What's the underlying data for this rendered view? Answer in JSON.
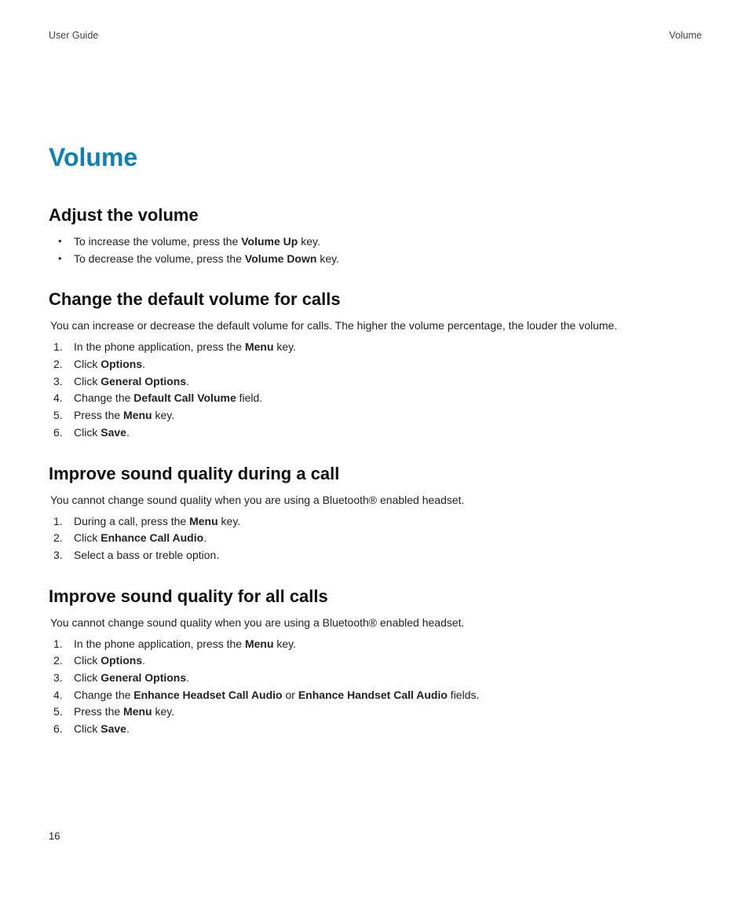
{
  "header": {
    "left": "User Guide",
    "right": "Volume"
  },
  "title": "Volume",
  "sections": [
    {
      "heading": "Adjust the volume",
      "intro": "",
      "listType": "ul",
      "items": [
        [
          {
            "t": "To increase the volume, press the "
          },
          {
            "t": "Volume Up",
            "b": true
          },
          {
            "t": " key."
          }
        ],
        [
          {
            "t": "To decrease the volume, press the "
          },
          {
            "t": "Volume Down",
            "b": true
          },
          {
            "t": " key."
          }
        ]
      ]
    },
    {
      "heading": "Change the default volume for calls",
      "intro": "You can increase or decrease the default volume for calls. The higher the volume percentage, the louder the volume.",
      "listType": "ol",
      "items": [
        [
          {
            "t": "In the phone application, press the "
          },
          {
            "t": "Menu",
            "b": true
          },
          {
            "t": " key."
          }
        ],
        [
          {
            "t": "Click "
          },
          {
            "t": "Options",
            "b": true
          },
          {
            "t": "."
          }
        ],
        [
          {
            "t": "Click "
          },
          {
            "t": "General Options",
            "b": true
          },
          {
            "t": "."
          }
        ],
        [
          {
            "t": "Change the "
          },
          {
            "t": "Default Call Volume",
            "b": true
          },
          {
            "t": " field."
          }
        ],
        [
          {
            "t": "Press the "
          },
          {
            "t": "Menu",
            "b": true
          },
          {
            "t": " key."
          }
        ],
        [
          {
            "t": "Click "
          },
          {
            "t": "Save",
            "b": true
          },
          {
            "t": "."
          }
        ]
      ]
    },
    {
      "heading": "Improve sound quality during a call",
      "intro": "You cannot change sound quality when you are using a Bluetooth® enabled headset.",
      "listType": "ol",
      "items": [
        [
          {
            "t": "During a call, press the "
          },
          {
            "t": "Menu",
            "b": true
          },
          {
            "t": " key."
          }
        ],
        [
          {
            "t": "Click "
          },
          {
            "t": "Enhance Call Audio",
            "b": true
          },
          {
            "t": "."
          }
        ],
        [
          {
            "t": "Select a bass or treble option."
          }
        ]
      ]
    },
    {
      "heading": "Improve sound quality for all calls",
      "intro": "You cannot change sound quality when you are using a Bluetooth® enabled headset.",
      "listType": "ol",
      "items": [
        [
          {
            "t": "In the phone application, press the "
          },
          {
            "t": "Menu",
            "b": true
          },
          {
            "t": " key."
          }
        ],
        [
          {
            "t": "Click "
          },
          {
            "t": "Options",
            "b": true
          },
          {
            "t": "."
          }
        ],
        [
          {
            "t": "Click "
          },
          {
            "t": "General Options",
            "b": true
          },
          {
            "t": "."
          }
        ],
        [
          {
            "t": "Change the "
          },
          {
            "t": "Enhance Headset Call Audio",
            "b": true
          },
          {
            "t": " or "
          },
          {
            "t": "Enhance Handset Call Audio",
            "b": true
          },
          {
            "t": " fields."
          }
        ],
        [
          {
            "t": "Press the "
          },
          {
            "t": "Menu",
            "b": true
          },
          {
            "t": " key."
          }
        ],
        [
          {
            "t": "Click "
          },
          {
            "t": "Save",
            "b": true
          },
          {
            "t": "."
          }
        ]
      ]
    }
  ],
  "pageNumber": "16"
}
